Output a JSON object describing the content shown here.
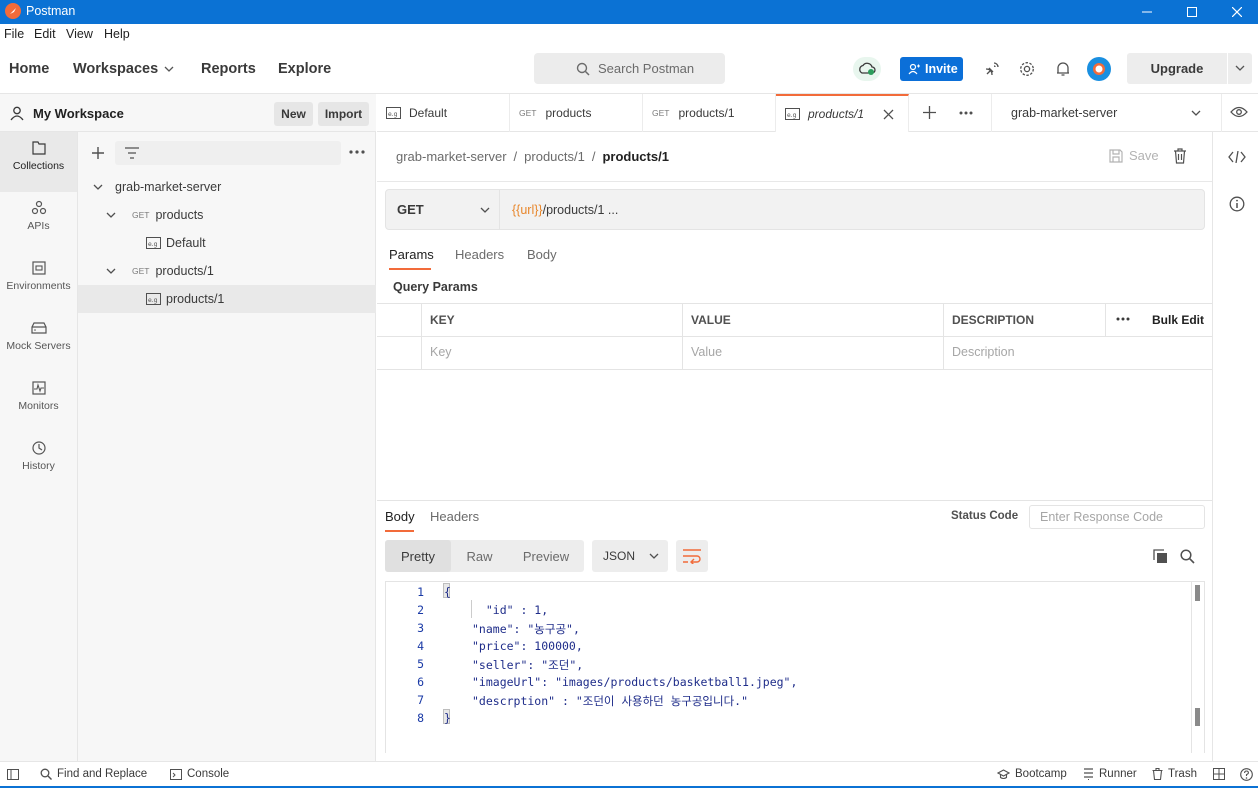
{
  "window": {
    "title": "Postman"
  },
  "menu": [
    "File",
    "Edit",
    "View",
    "Help"
  ],
  "header": {
    "nav": [
      "Home",
      "Workspaces",
      "Reports",
      "Explore"
    ],
    "search_placeholder": "Search Postman",
    "invite_label": "Invite",
    "upgrade_label": "Upgrade"
  },
  "leftnav": [
    {
      "label": "Collections",
      "icon": "collections-icon"
    },
    {
      "label": "APIs",
      "icon": "apis-icon"
    },
    {
      "label": "Environments",
      "icon": "environments-icon"
    },
    {
      "label": "Mock Servers",
      "icon": "mock-servers-icon"
    },
    {
      "label": "Monitors",
      "icon": "monitors-icon"
    },
    {
      "label": "History",
      "icon": "history-icon"
    }
  ],
  "workspace": {
    "name": "My Workspace",
    "new_label": "New",
    "import_label": "Import"
  },
  "tree": {
    "collection": "grab-market-server",
    "items": [
      {
        "method": "GET",
        "label": "products"
      },
      {
        "label": "Default"
      },
      {
        "method": "GET",
        "label": "products/1"
      },
      {
        "label": "products/1"
      }
    ]
  },
  "tabs": [
    {
      "label": "Default"
    },
    {
      "method": "GET",
      "label": "products"
    },
    {
      "method": "GET",
      "label": "products/1"
    },
    {
      "label": "products/1"
    }
  ],
  "environment": "grab-market-server",
  "breadcrumb": {
    "part1": "grab-market-server",
    "sep": "/",
    "part2": "products/1",
    "current": "products/1"
  },
  "save_label": "Save",
  "request": {
    "method": "GET",
    "url_var": "{{url}}",
    "url_path": "/products/1 ..."
  },
  "request_tabs": [
    "Params",
    "Headers",
    "Body"
  ],
  "query_params": {
    "title": "Query Params",
    "headers": [
      "KEY",
      "VALUE",
      "DESCRIPTION"
    ],
    "bulk_edit": "Bulk Edit",
    "placeholders": [
      "Key",
      "Value",
      "Description"
    ]
  },
  "response": {
    "tabs": [
      "Body",
      "Headers"
    ],
    "status_code_label": "Status Code",
    "status_code_placeholder": "Enter Response Code",
    "views": [
      "Pretty",
      "Raw",
      "Preview"
    ],
    "format": "JSON",
    "code_lines": [
      "{",
      "  \"id\" : 1,",
      "\"name\": \"농구공\",",
      "\"price\": 100000,",
      "\"seller\": \"조던\",",
      "\"imageUrl\": \"images/products/basketball1.jpeg\",",
      "\"descrption\" : \"조던이 사용하던 농구공입니다.\"",
      "}"
    ],
    "line_numbers": [
      "1",
      "2",
      "3",
      "4",
      "5",
      "6",
      "7",
      "8"
    ]
  },
  "statusbar": {
    "find_replace": "Find and Replace",
    "console": "Console",
    "bootcamp": "Bootcamp",
    "runner": "Runner",
    "trash": "Trash"
  },
  "colors": {
    "accent": "#f26b3a",
    "titlebar": "#0b72d4",
    "invite": "#0b6fd8"
  }
}
